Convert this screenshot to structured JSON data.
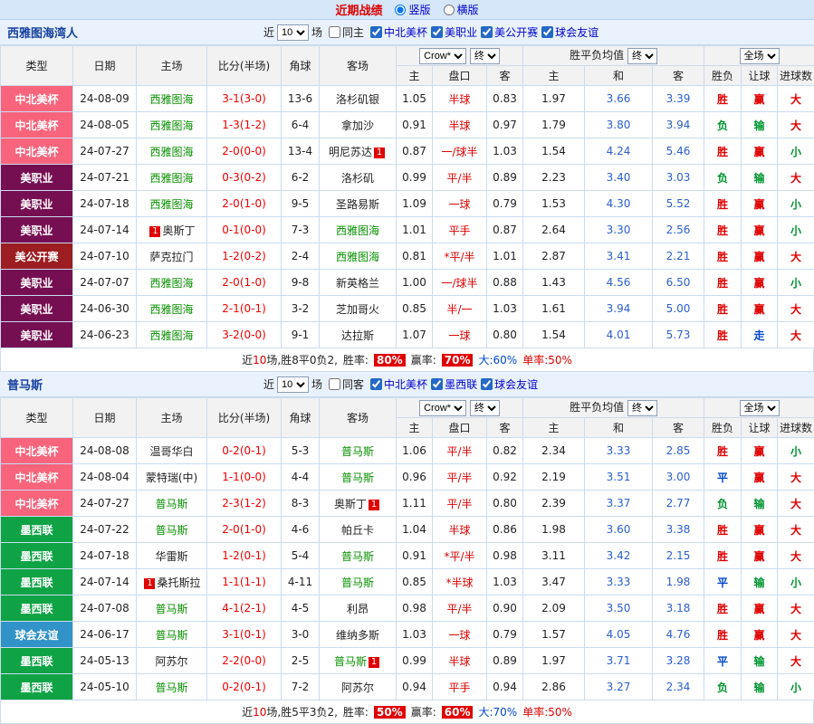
{
  "top_bar": {
    "title": "近期战绩",
    "orientation_options": [
      {
        "label": "竖版",
        "selected": true
      },
      {
        "label": "横版",
        "selected": false
      }
    ]
  },
  "table_header": {
    "type": "类型",
    "date": "日期",
    "home": "主场",
    "score": "比分(半场)",
    "corner": "角球",
    "away": "客场",
    "bookmaker_select": "Crow*",
    "final_select": "终",
    "odds_home": "主",
    "odds_handicap": "盘口",
    "odds_away": "客",
    "europe_label": "胜平负均值",
    "europe_home": "主",
    "europe_draw": "和",
    "europe_away": "客",
    "scope_select": "全场",
    "result": "胜负",
    "handicap_result": "让球",
    "goals": "进球数"
  },
  "type_colors": {
    "中北美杯": "#f8647c",
    "美职业": "#750f52",
    "美公开赛": "#9c1d22",
    "墨西联": "#0fa345",
    "球会友谊": "#3193c7"
  },
  "sections": [
    {
      "team": "西雅图海湾人",
      "filter": {
        "near": "近",
        "count": "10",
        "games": "场",
        "same": "同主",
        "same_checked": false,
        "leagues": [
          {
            "label": "中北美杯",
            "checked": true
          },
          {
            "label": "美职业",
            "checked": true
          },
          {
            "label": "美公开赛",
            "checked": true
          },
          {
            "label": "球会友谊",
            "checked": true
          }
        ]
      },
      "rows": [
        {
          "type": "中北美杯",
          "date": "24-08-09",
          "home": "西雅图海",
          "home_green": true,
          "score": "3-1(3-0)",
          "corner": "13-6",
          "away": "洛杉矶银",
          "away_green": false,
          "ah_home": "1.05",
          "ah_line": "半球",
          "ah_away": "0.83",
          "eu_home": "1.97",
          "eu_draw": "3.66",
          "eu_away": "3.39",
          "result": "胜",
          "handicap": "赢",
          "goals": "大"
        },
        {
          "type": "中北美杯",
          "date": "24-08-05",
          "home": "西雅图海",
          "home_green": true,
          "score": "1-3(1-2)",
          "corner": "6-4",
          "away": "拿加沙",
          "away_green": false,
          "ah_home": "0.91",
          "ah_line": "半球",
          "ah_away": "0.97",
          "eu_home": "1.79",
          "eu_draw": "3.80",
          "eu_away": "3.94",
          "result": "负",
          "handicap": "输",
          "goals": "大"
        },
        {
          "type": "中北美杯",
          "date": "24-07-27",
          "home": "西雅图海",
          "home_green": true,
          "score": "2-0(0-0)",
          "corner": "13-4",
          "away": "明尼苏达",
          "away_green": false,
          "away_badge": "1",
          "away_badge_pos": "after",
          "ah_home": "0.87",
          "ah_line": "一/球半",
          "ah_away": "1.03",
          "eu_home": "1.54",
          "eu_draw": "4.24",
          "eu_away": "5.46",
          "result": "胜",
          "handicap": "赢",
          "goals": "小"
        },
        {
          "type": "美职业",
          "date": "24-07-21",
          "home": "西雅图海",
          "home_green": true,
          "score": "0-3(0-2)",
          "corner": "6-2",
          "away": "洛杉矶",
          "away_green": false,
          "ah_home": "0.99",
          "ah_line": "平/半",
          "ah_away": "0.89",
          "eu_home": "2.23",
          "eu_draw": "3.40",
          "eu_away": "3.03",
          "result": "负",
          "handicap": "输",
          "goals": "大"
        },
        {
          "type": "美职业",
          "date": "24-07-18",
          "home": "西雅图海",
          "home_green": true,
          "score": "2-0(1-0)",
          "corner": "9-5",
          "away": "圣路易斯",
          "away_green": false,
          "ah_home": "1.09",
          "ah_line": "一球",
          "ah_away": "0.79",
          "eu_home": "1.53",
          "eu_draw": "4.30",
          "eu_away": "5.52",
          "result": "胜",
          "handicap": "赢",
          "goals": "小"
        },
        {
          "type": "美职业",
          "date": "24-07-14",
          "home": "奥斯丁",
          "home_green": false,
          "home_badge": "1",
          "home_badge_pos": "before",
          "score": "0-1(0-0)",
          "corner": "7-3",
          "away": "西雅图海",
          "away_green": true,
          "ah_home": "1.01",
          "ah_line": "平手",
          "ah_away": "0.87",
          "eu_home": "2.64",
          "eu_draw": "3.30",
          "eu_away": "2.56",
          "result": "胜",
          "handicap": "赢",
          "goals": "小"
        },
        {
          "type": "美公开赛",
          "date": "24-07-10",
          "home": "萨克拉门",
          "home_green": false,
          "score": "1-2(0-2)",
          "corner": "2-4",
          "away": "西雅图海",
          "away_green": true,
          "ah_home": "0.81",
          "ah_line": "*平/半",
          "ah_away": "1.01",
          "eu_home": "2.87",
          "eu_draw": "3.41",
          "eu_away": "2.21",
          "result": "胜",
          "handicap": "赢",
          "goals": "大"
        },
        {
          "type": "美职业",
          "date": "24-07-07",
          "home": "西雅图海",
          "home_green": true,
          "score": "2-0(1-0)",
          "corner": "9-8",
          "away": "新英格兰",
          "away_green": false,
          "ah_home": "1.00",
          "ah_line": "一/球半",
          "ah_away": "0.88",
          "eu_home": "1.43",
          "eu_draw": "4.56",
          "eu_away": "6.50",
          "result": "胜",
          "handicap": "赢",
          "goals": "小"
        },
        {
          "type": "美职业",
          "date": "24-06-30",
          "home": "西雅图海",
          "home_green": true,
          "score": "2-1(0-1)",
          "corner": "3-2",
          "away": "芝加哥火",
          "away_green": false,
          "ah_home": "0.85",
          "ah_line": "半/一",
          "ah_away": "1.03",
          "eu_home": "1.61",
          "eu_draw": "3.94",
          "eu_away": "5.00",
          "result": "胜",
          "handicap": "赢",
          "goals": "大"
        },
        {
          "type": "美职业",
          "date": "24-06-23",
          "home": "西雅图海",
          "home_green": true,
          "score": "3-2(0-0)",
          "corner": "9-1",
          "away": "达拉斯",
          "away_green": false,
          "ah_home": "1.07",
          "ah_line": "一球",
          "ah_away": "0.80",
          "eu_home": "1.54",
          "eu_draw": "4.01",
          "eu_away": "5.73",
          "result": "胜",
          "handicap": "走",
          "goals": "大"
        }
      ],
      "footer": {
        "prefix": "近",
        "count": "10",
        "record": "场,胜8平0负2,",
        "win_rate_label": "胜率:",
        "win_rate": "80%",
        "handicap_rate_label": "赢率:",
        "handicap_rate": "70%",
        "big_label": "大:",
        "big_rate": "60%",
        "single_label": "单率:",
        "single_rate": "50%"
      }
    },
    {
      "team": "普马斯",
      "filter": {
        "near": "近",
        "count": "10",
        "games": "场",
        "same": "同客",
        "same_checked": false,
        "leagues": [
          {
            "label": "中北美杯",
            "checked": true
          },
          {
            "label": "墨西联",
            "checked": true
          },
          {
            "label": "球会友谊",
            "checked": true
          }
        ]
      },
      "rows": [
        {
          "type": "中北美杯",
          "date": "24-08-08",
          "home": "温哥华白",
          "home_green": false,
          "score": "0-2(0-1)",
          "corner": "5-3",
          "away": "普马斯",
          "away_green": true,
          "ah_home": "1.06",
          "ah_line": "平/半",
          "ah_away": "0.82",
          "eu_home": "2.34",
          "eu_draw": "3.33",
          "eu_away": "2.85",
          "result": "胜",
          "handicap": "赢",
          "goals": "小"
        },
        {
          "type": "中北美杯",
          "date": "24-08-04",
          "home": "蒙特瑞(中)",
          "home_green": false,
          "score": "1-1(0-0)",
          "corner": "4-4",
          "away": "普马斯",
          "away_green": true,
          "ah_home": "0.96",
          "ah_line": "平/半",
          "ah_away": "0.92",
          "eu_home": "2.19",
          "eu_draw": "3.51",
          "eu_away": "3.00",
          "result": "平",
          "handicap": "赢",
          "goals": "大"
        },
        {
          "type": "中北美杯",
          "date": "24-07-27",
          "home": "普马斯",
          "home_green": true,
          "score": "2-3(1-2)",
          "corner": "8-3",
          "away": "奥斯丁",
          "away_green": false,
          "away_badge": "1",
          "away_badge_pos": "after",
          "ah_home": "1.11",
          "ah_line": "平/半",
          "ah_away": "0.80",
          "eu_home": "2.39",
          "eu_draw": "3.37",
          "eu_away": "2.77",
          "result": "负",
          "handicap": "输",
          "goals": "大"
        },
        {
          "type": "墨西联",
          "date": "24-07-22",
          "home": "普马斯",
          "home_green": true,
          "score": "2-0(1-0)",
          "corner": "4-6",
          "away": "帕丘卡",
          "away_green": false,
          "ah_home": "1.04",
          "ah_line": "半球",
          "ah_away": "0.86",
          "eu_home": "1.98",
          "eu_draw": "3.60",
          "eu_away": "3.38",
          "result": "胜",
          "handicap": "赢",
          "goals": "大"
        },
        {
          "type": "墨西联",
          "date": "24-07-18",
          "home": "华雷斯",
          "home_green": false,
          "score": "1-2(0-1)",
          "corner": "5-4",
          "away": "普马斯",
          "away_green": true,
          "ah_home": "0.91",
          "ah_line": "*平/半",
          "ah_away": "0.98",
          "eu_home": "3.11",
          "eu_draw": "3.42",
          "eu_away": "2.15",
          "result": "胜",
          "handicap": "赢",
          "goals": "大"
        },
        {
          "type": "墨西联",
          "date": "24-07-14",
          "home": "桑托斯拉",
          "home_green": false,
          "home_badge": "1",
          "home_badge_pos": "before",
          "score": "1-1(1-1)",
          "corner": "4-11",
          "away": "普马斯",
          "away_green": true,
          "ah_home": "0.85",
          "ah_line": "*半球",
          "ah_away": "1.03",
          "eu_home": "3.47",
          "eu_draw": "3.33",
          "eu_away": "1.98",
          "result": "平",
          "handicap": "输",
          "goals": "小"
        },
        {
          "type": "墨西联",
          "date": "24-07-08",
          "home": "普马斯",
          "home_green": true,
          "score": "4-1(2-1)",
          "corner": "4-5",
          "away": "利昂",
          "away_green": false,
          "ah_home": "0.98",
          "ah_line": "平/半",
          "ah_away": "0.90",
          "eu_home": "2.09",
          "eu_draw": "3.50",
          "eu_away": "3.18",
          "result": "胜",
          "handicap": "赢",
          "goals": "大"
        },
        {
          "type": "球会友谊",
          "date": "24-06-17",
          "home": "普马斯",
          "home_green": true,
          "score": "3-1(0-1)",
          "corner": "3-0",
          "away": "维纳多斯",
          "away_green": false,
          "ah_home": "1.03",
          "ah_line": "一球",
          "ah_away": "0.79",
          "eu_home": "1.57",
          "eu_draw": "4.05",
          "eu_away": "4.76",
          "result": "胜",
          "handicap": "赢",
          "goals": "大"
        },
        {
          "type": "墨西联",
          "date": "24-05-13",
          "home": "阿苏尔",
          "home_green": false,
          "score": "2-2(0-0)",
          "corner": "2-5",
          "away": "普马斯",
          "away_green": true,
          "away_badge": "1",
          "away_badge_pos": "after",
          "ah_home": "0.99",
          "ah_line": "半球",
          "ah_away": "0.89",
          "eu_home": "1.97",
          "eu_draw": "3.71",
          "eu_away": "3.28",
          "result": "平",
          "handicap": "输",
          "goals": "大"
        },
        {
          "type": "墨西联",
          "date": "24-05-10",
          "home": "普马斯",
          "home_green": true,
          "score": "0-2(0-1)",
          "corner": "7-2",
          "away": "阿苏尔",
          "away_green": false,
          "ah_home": "0.94",
          "ah_line": "平手",
          "ah_away": "0.94",
          "eu_home": "2.86",
          "eu_draw": "3.27",
          "eu_away": "2.34",
          "result": "负",
          "handicap": "输",
          "goals": "小"
        }
      ],
      "footer": {
        "prefix": "近",
        "count": "10",
        "record": "场,胜5平3负2,",
        "win_rate_label": "胜率:",
        "win_rate": "50%",
        "handicap_rate_label": "赢率:",
        "handicap_rate": "60%",
        "big_label": "大:",
        "big_rate": "70%",
        "single_label": "单率:",
        "single_rate": "50%"
      }
    }
  ]
}
